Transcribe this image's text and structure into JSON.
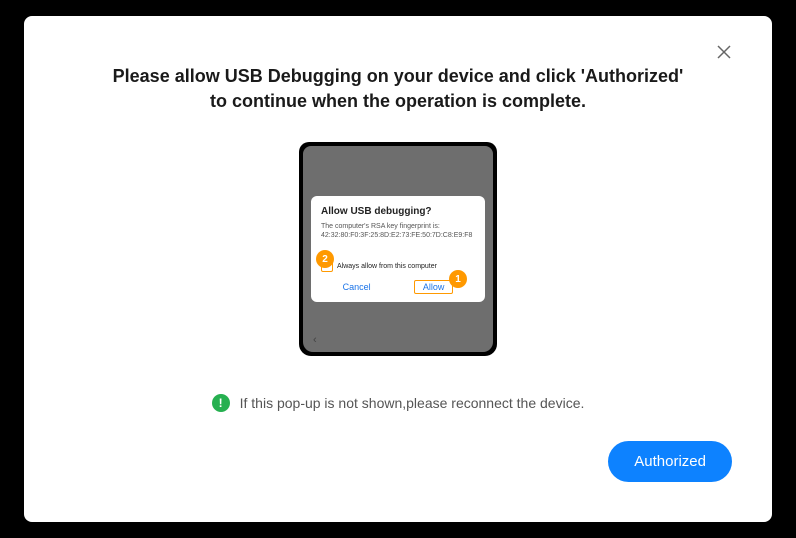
{
  "modal": {
    "title": "Please allow USB Debugging on your device and click 'Authorized' to continue when the operation is complete."
  },
  "phone_dialog": {
    "title": "Allow USB debugging?",
    "subtitle": "The computer's RSA key fingerprint is:",
    "fingerprint": "42:32:80:F0:3F:25:8D:E2:73:FE:50:7D:C8:E9:F8",
    "checkbox_label": "Always allow from this computer",
    "cancel": "Cancel",
    "allow": "Allow",
    "badge_1": "1",
    "badge_2": "2"
  },
  "warning": {
    "icon_glyph": "!",
    "text": "If this pop-up is not shown,please reconnect the device."
  },
  "actions": {
    "authorized": "Authorized"
  }
}
